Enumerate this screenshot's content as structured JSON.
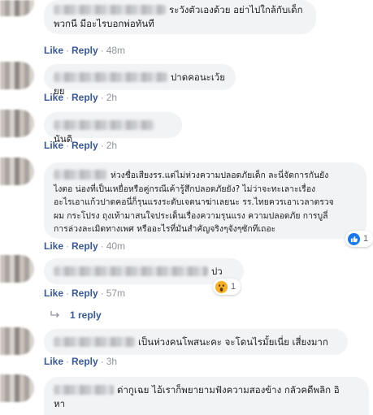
{
  "actions": {
    "like": "Like",
    "reply": "Reply",
    "dot": "·"
  },
  "comments": [
    {
      "text_lines": [
        "ระวังตัวเองด้วย อย่าไปใกล้กับเด็ก",
        "พวกนี มีอะไรบอกพ่อทันที"
      ],
      "time": "48m"
    },
    {
      "text_lines": [
        "ปาดคอนะเว้ยยย"
      ],
      "time": "2h"
    },
    {
      "text_lines": [
        "นันดิ"
      ],
      "time": "2h"
    },
    {
      "text_lines": [
        "ห่วงชื่อเสียงรร.แต่ไม่ห่วงความปลอดภัยเด็ก ละนี่จัดการกันยัง",
        "ไงตอ น่องที่เป็นเหยื่อหรือคู่กรณีเค้ารู้สึกปลอดภัยยัง? ไม่ว่าจะทะเลาะเรื่อง",
        "อะไรเอาแก้วปาดคอนี่ก็รุนแรงระดับเจตนาฆ่าเลยนะ รร.ไทยควรเอาเวลาตรวจ",
        "ผม กระโปรง ถุงเท้ามาสนใจประเด็นเรื่องความรุนแรง ความปลอดภัย การบูลี่",
        "การล่วงละเมิดทางเพศ หรืออะไรที่มันสำคัญจริงๆจังๆซักทีเถอะ"
      ],
      "time": "40m",
      "reaction_count": "1"
    },
    {
      "text_lines": [
        "ปว"
      ],
      "time": "57m",
      "reaction_count": "1",
      "replies": "1 reply"
    },
    {
      "text_lines": [
        "เป็นห่วงคนโพสนะคะ จะโดนไรมั้ยเนี่ย เสี่ยงมาก"
      ],
      "time": "3h"
    },
    {
      "text_lines": [
        "ด่ากูเฉย ไอ้เราก็พยายามฟังความสองข้าง กลัวคดีพลิก อิ",
        "หา"
      ]
    }
  ],
  "icons": {
    "like": "like-reaction-icon",
    "wow": "wow-reaction-icon",
    "reply": "reply-arrow-icon"
  },
  "colors": {
    "link": "#385898",
    "meta": "#90949c",
    "bubble": "#f2f3f5",
    "like_blue": "#1877f2"
  }
}
